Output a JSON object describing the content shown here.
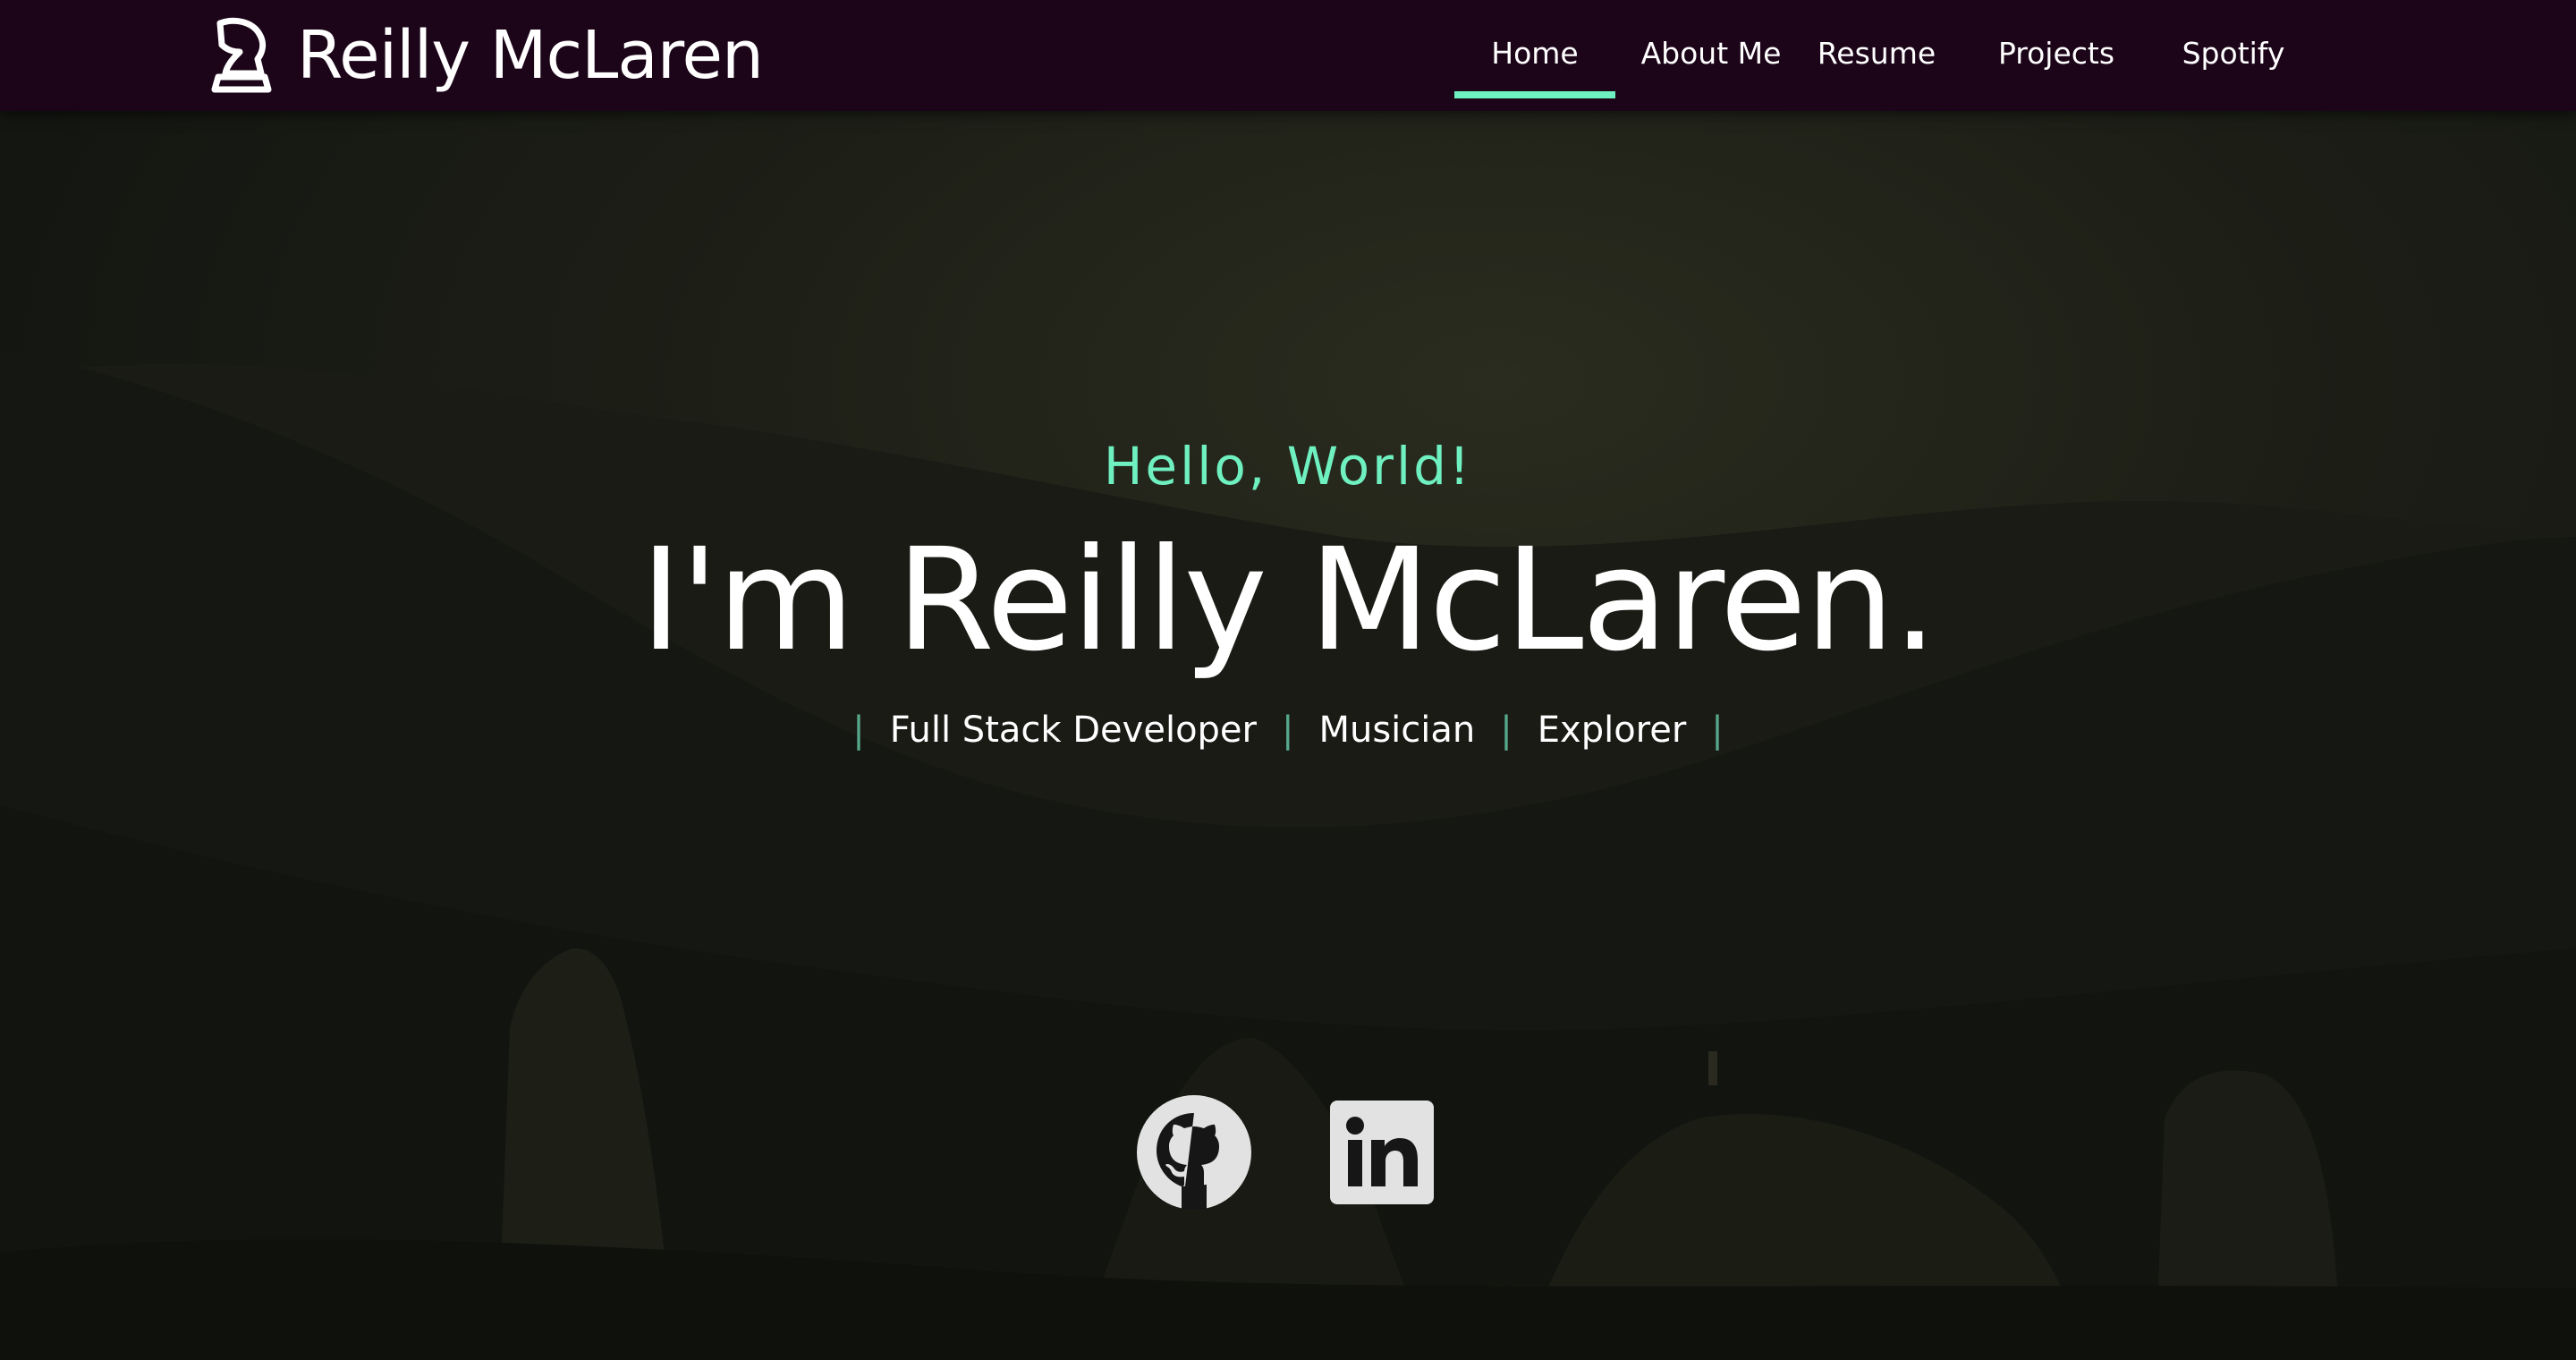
{
  "brand": {
    "name": "Reilly McLaren",
    "icon": "chess-knight-icon"
  },
  "nav": {
    "items": [
      {
        "label": "Home",
        "active": true
      },
      {
        "label": "About Me",
        "active": false
      },
      {
        "label": "Resume",
        "active": false
      },
      {
        "label": "Projects",
        "active": false
      },
      {
        "label": "Spotify",
        "active": false
      }
    ]
  },
  "hero": {
    "greeting": "Hello, World!",
    "headline": "I'm Reilly McLaren.",
    "separator": "|",
    "roles": [
      "Full Stack Developer",
      "Musician",
      "Explorer"
    ]
  },
  "social": [
    {
      "icon": "github-icon"
    },
    {
      "icon": "linkedin-icon"
    }
  ],
  "colors": {
    "navbar_bg": "#1c0519",
    "accent": "#6ff0c0",
    "separator": "#56a88c",
    "text": "#ffffff",
    "page_bg": "#141611"
  }
}
